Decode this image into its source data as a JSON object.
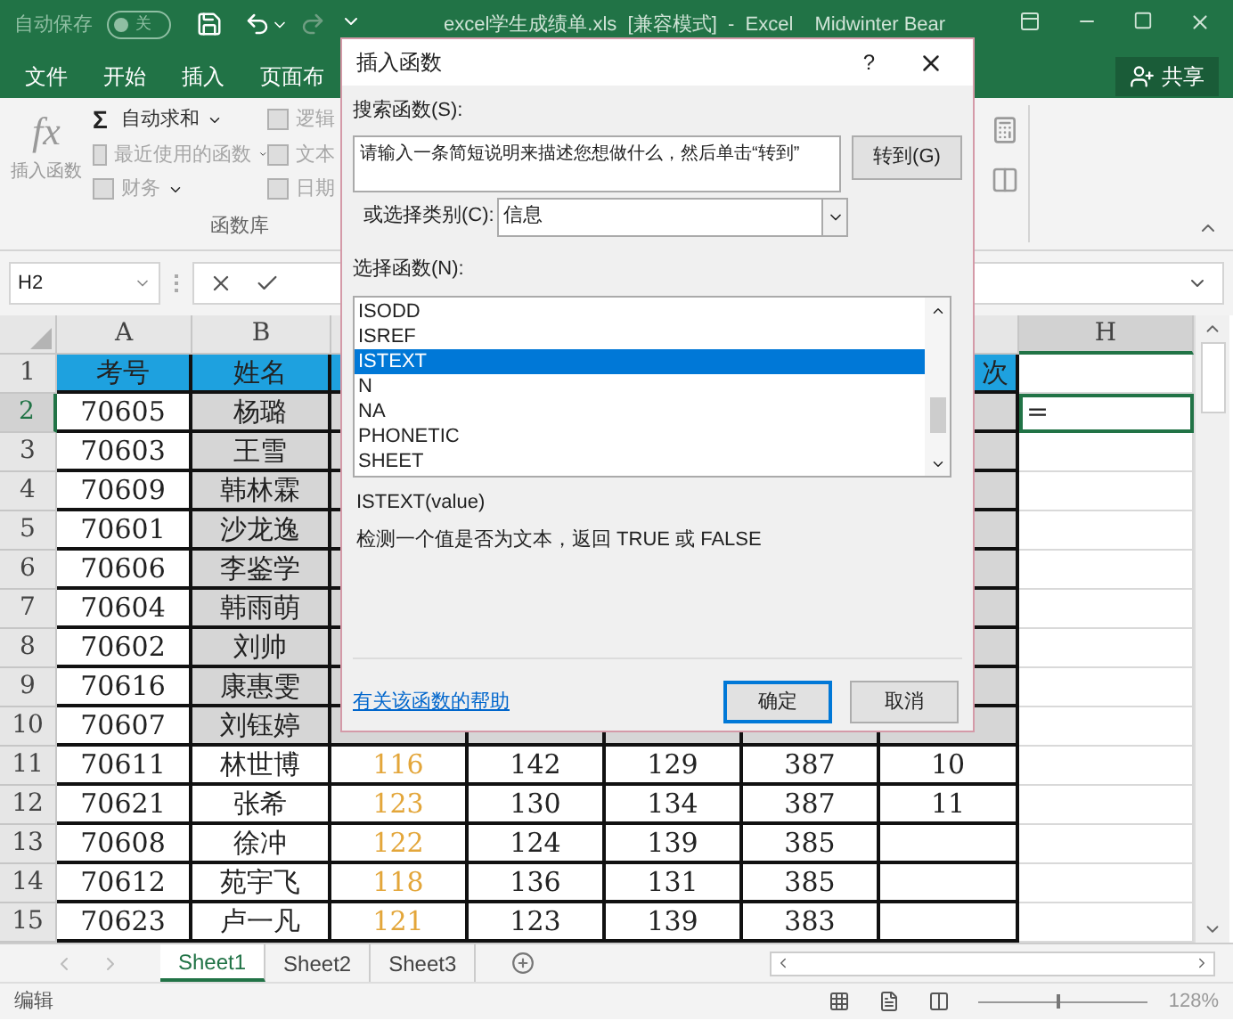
{
  "title_bar": {
    "autosave_label": "自动保存",
    "autosave_state": "关",
    "autosave_on": false,
    "title": "excel学生成绩单.xls  [兼容模式]  -  Excel",
    "user": "Midwinter Bear"
  },
  "ribbon_tabs": [
    {
      "label": "文件",
      "selected": false
    },
    {
      "label": "开始",
      "selected": false
    },
    {
      "label": "插入",
      "selected": false
    },
    {
      "label": "页面布",
      "selected": false
    }
  ],
  "share_button": "共享",
  "ribbon": {
    "insert_function": {
      "glyph": "fx",
      "label": "插入函数"
    },
    "items": [
      {
        "glyph": "Σ",
        "label": "自动求和",
        "dropdown": true,
        "disabled": false
      },
      {
        "label": "最近使用的函数",
        "dropdown": true,
        "disabled": true
      },
      {
        "label": "财务",
        "dropdown": true,
        "disabled": true
      }
    ],
    "items2": [
      {
        "label": "逻辑",
        "disabled": true
      },
      {
        "label": "文本",
        "disabled": true
      },
      {
        "label": "日期",
        "disabled": true
      }
    ],
    "group_label": "函数库"
  },
  "formula_bar": {
    "name_box": "H2"
  },
  "columns": [
    {
      "letter": "A"
    },
    {
      "letter": "B"
    },
    {},
    {},
    {},
    {},
    {},
    {
      "letter": "H"
    }
  ],
  "rows": [
    {
      "label": "1",
      "kind": "header",
      "shaded": false,
      "cells": [
        "考号",
        "姓名",
        null,
        null,
        null,
        null,
        "次",
        null
      ]
    },
    {
      "label": "2",
      "kind": "data",
      "shaded": true,
      "cells": [
        "70605",
        "杨璐",
        null,
        null,
        null,
        null,
        null,
        {
          "text": "=",
          "selected": true
        }
      ]
    },
    {
      "label": "3",
      "kind": "data",
      "shaded": true,
      "cells": [
        "70603",
        "王雪",
        null,
        null,
        null,
        null,
        null,
        null
      ]
    },
    {
      "label": "4",
      "kind": "data",
      "shaded": true,
      "cells": [
        "70609",
        "韩林霖",
        null,
        null,
        null,
        null,
        null,
        null
      ]
    },
    {
      "label": "5",
      "kind": "data",
      "shaded": true,
      "cells": [
        "70601",
        "沙龙逸",
        null,
        null,
        null,
        null,
        null,
        null
      ]
    },
    {
      "label": "6",
      "kind": "data",
      "shaded": true,
      "cells": [
        "70606",
        "李鉴学",
        null,
        null,
        null,
        null,
        null,
        null
      ]
    },
    {
      "label": "7",
      "kind": "data",
      "shaded": true,
      "cells": [
        "70604",
        "韩雨萌",
        null,
        null,
        null,
        null,
        null,
        null
      ]
    },
    {
      "label": "8",
      "kind": "data",
      "shaded": true,
      "cells": [
        "70602",
        "刘帅",
        null,
        null,
        null,
        null,
        null,
        null
      ]
    },
    {
      "label": "9",
      "kind": "data",
      "shaded": true,
      "cells": [
        "70616",
        "康惠雯",
        null,
        null,
        null,
        null,
        null,
        null
      ]
    },
    {
      "label": "10",
      "kind": "data",
      "shaded": true,
      "cells": [
        "70607",
        "刘钰婷",
        null,
        null,
        null,
        null,
        null,
        null
      ]
    },
    {
      "label": "11",
      "kind": "data",
      "shaded": false,
      "cells": [
        "70611",
        "林世博",
        {
          "text": "116",
          "color": "#e3a63a"
        },
        "142",
        "129",
        "387",
        "10",
        null
      ]
    },
    {
      "label": "12",
      "kind": "data",
      "shaded": false,
      "cells": [
        "70621",
        "张希",
        {
          "text": "123",
          "color": "#e3a63a"
        },
        "130",
        "134",
        "387",
        "11",
        null
      ]
    },
    {
      "label": "13",
      "kind": "data",
      "shaded": false,
      "cells": [
        "70608",
        "徐冲",
        {
          "text": "122",
          "color": "#e3a63a"
        },
        "124",
        "139",
        "385",
        null,
        null
      ]
    },
    {
      "label": "14",
      "kind": "data",
      "shaded": false,
      "cells": [
        "70612",
        "苑宇飞",
        {
          "text": "118",
          "color": "#e3a63a"
        },
        "136",
        "131",
        "385",
        null,
        null
      ]
    },
    {
      "label": "15",
      "kind": "data",
      "shaded": false,
      "cells": [
        "70623",
        "卢一凡",
        {
          "text": "121",
          "color": "#e3a63a"
        },
        "123",
        "139",
        "383",
        null,
        null
      ]
    }
  ],
  "sheet_tabs": [
    {
      "label": "Sheet1",
      "selected": true
    },
    {
      "label": "Sheet2",
      "selected": false
    },
    {
      "label": "Sheet3",
      "selected": false
    }
  ],
  "status_bar": {
    "mode": "编辑",
    "zoom_slider": {
      "level": 0.48
    },
    "zoom": "128%"
  },
  "dialog": {
    "title": "插入函数",
    "help": "?",
    "search_label": "搜索函数(S):",
    "search_value": "请输入一条简短说明来描述您想做什么，然后单击“转到”",
    "go_button": "转到(G)",
    "category_label": "或选择类别(C):",
    "category_value": "信息",
    "list_label": "选择函数(N):",
    "functions": [
      {
        "name": "ISODD",
        "selected": false
      },
      {
        "name": "ISREF",
        "selected": false
      },
      {
        "name": "ISTEXT",
        "selected": true
      },
      {
        "name": "N",
        "selected": false
      },
      {
        "name": "NA",
        "selected": false
      },
      {
        "name": "PHONETIC",
        "selected": false
      },
      {
        "name": "SHEET",
        "selected": false
      }
    ],
    "syntax": "ISTEXT(value)",
    "description": "检测一个值是否为文本，返回 TRUE 或 FALSE",
    "help_link": "有关该函数的帮助",
    "buttons": [
      {
        "label": "确定",
        "default": true
      },
      {
        "label": "取消",
        "default": false
      }
    ]
  }
}
